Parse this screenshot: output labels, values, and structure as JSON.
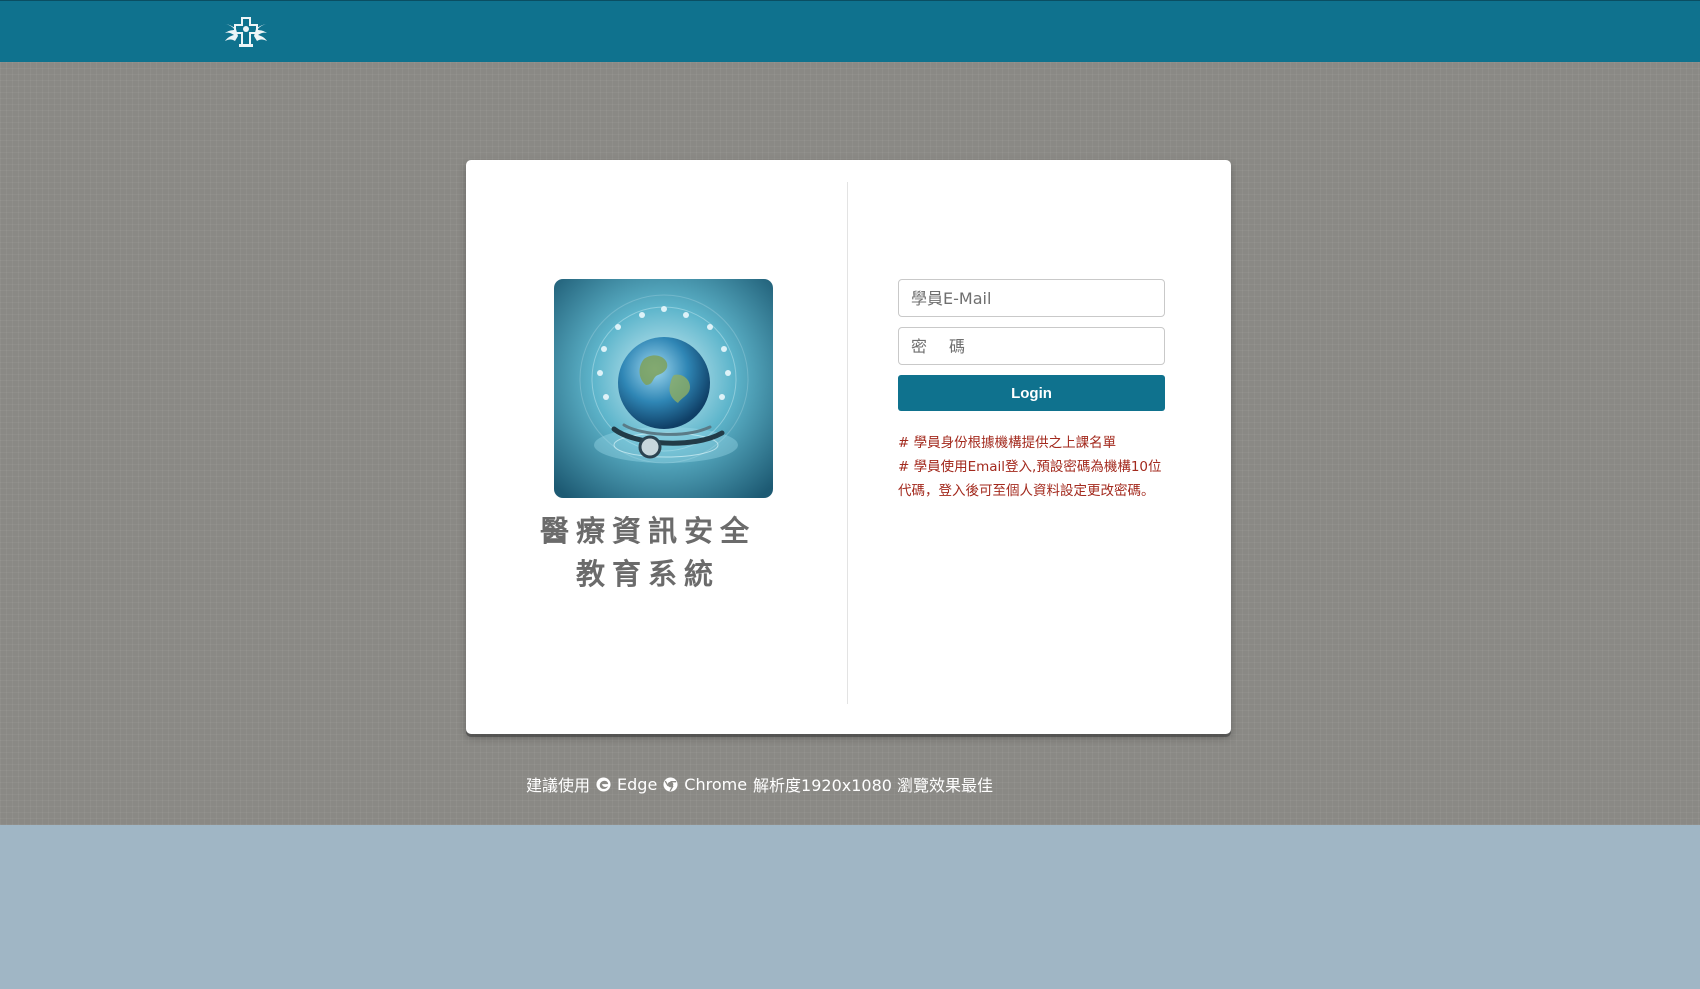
{
  "header": {
    "logo_icon": "winged-cross-emblem-icon"
  },
  "hero": {
    "image_icon": "globe-stethoscope-illustration-icon",
    "title_line1": "醫療資訊安全",
    "title_line2": "教育系統"
  },
  "login_form": {
    "email_placeholder": "學員E-Mail",
    "password_placeholder": "密　碼",
    "login_label": "Login"
  },
  "notes": {
    "line1": "# 學員身份根據機構提供之上課名單",
    "line2": "# 學員使用Email登入,預設密碼為機構10位代碼，登入後可至個人資料設定更改密碼。"
  },
  "footer": {
    "prefix": "建議使用",
    "browser1": "Edge",
    "browser2": "Chrome",
    "suffix": "解析度1920x1080 瀏覽效果最佳",
    "edge_icon": "edge-icon",
    "chrome_icon": "chrome-icon"
  },
  "colors": {
    "brand": "#0f728e",
    "page_background": "#8a8985",
    "lower_background": "#a0b6c5",
    "notice_text": "#a32a1e"
  }
}
